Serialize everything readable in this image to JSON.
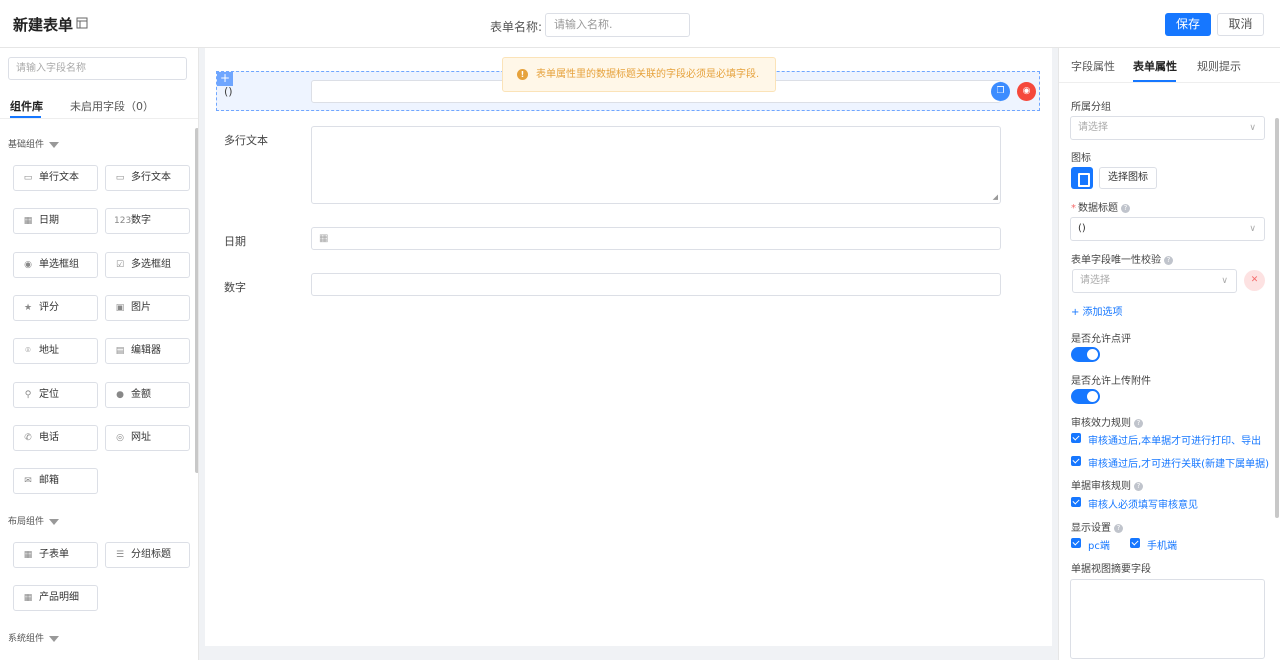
{
  "header": {
    "title": "新建表单",
    "form_name_label": "表单名称:",
    "form_name_placeholder": "请输入名称.",
    "save_label": "保存",
    "cancel_label": "取消"
  },
  "left_panel": {
    "search_placeholder": "请输入字段名称",
    "tabs": [
      "组件库",
      "未启用字段（0）"
    ],
    "sections": {
      "basic": "基础组件",
      "layout": "布局组件",
      "system": "系统组件"
    },
    "basic_components": [
      {
        "label": "单行文本",
        "icon": "single-line-icon",
        "glyph": "▭"
      },
      {
        "label": "多行文本",
        "icon": "multi-line-icon",
        "glyph": "▭"
      },
      {
        "label": "日期",
        "icon": "calendar-icon",
        "glyph": "▦"
      },
      {
        "label": "数字",
        "icon": "number-icon",
        "glyph": "123"
      },
      {
        "label": "单选框组",
        "icon": "radio-icon",
        "glyph": "◉"
      },
      {
        "label": "多选框组",
        "icon": "checkbox-icon",
        "glyph": "☑"
      },
      {
        "label": "评分",
        "icon": "star-icon",
        "glyph": "★"
      },
      {
        "label": "图片",
        "icon": "image-icon",
        "glyph": "▣"
      },
      {
        "label": "地址",
        "icon": "location-pin-icon",
        "glyph": "⌾"
      },
      {
        "label": "编辑器",
        "icon": "editor-icon",
        "glyph": "▤"
      },
      {
        "label": "定位",
        "icon": "position-icon",
        "glyph": "⚲"
      },
      {
        "label": "金额",
        "icon": "money-icon",
        "glyph": "●"
      },
      {
        "label": "电话",
        "icon": "phone-icon",
        "glyph": "✆"
      },
      {
        "label": "网址",
        "icon": "globe-icon",
        "glyph": "◎"
      },
      {
        "label": "邮箱",
        "icon": "mail-icon",
        "glyph": "✉"
      }
    ],
    "layout_components": [
      {
        "label": "子表单",
        "icon": "table-icon",
        "glyph": "▦"
      },
      {
        "label": "分组标题",
        "icon": "group-title-icon",
        "glyph": "☰"
      },
      {
        "label": "产品明细",
        "icon": "product-detail-icon",
        "glyph": "▦"
      }
    ]
  },
  "canvas": {
    "toast": "表单属性里的数据标题关联的字段必须是必填字段.",
    "fields": [
      {
        "label": "()"
      },
      {
        "label": "多行文本"
      },
      {
        "label": "日期"
      },
      {
        "label": "数字"
      }
    ]
  },
  "right_panel": {
    "tabs": [
      "字段属性",
      "表单属性",
      "规则提示"
    ],
    "group_label": "所属分组",
    "group_placeholder": "请选择",
    "icon_label": "图标",
    "choose_icon_label": "选择图标",
    "data_title_label": "数据标题",
    "data_title_value": "()",
    "unique_label": "表单字段唯一性校验",
    "unique_placeholder": "请选择",
    "add_option_label": "+ 添加选项",
    "allow_comment_label": "是否允许点评",
    "allow_attachment_label": "是否允许上传附件",
    "audit_rule_label": "审核效力规则",
    "audit_rules": [
      "审核通过后,本单据才可进行打印、导出",
      "审核通过后,才可进行关联(新建下属单据)"
    ],
    "doc_audit_label": "单据审核规则",
    "doc_audit_rules": [
      "审核人必须填写审核意见"
    ],
    "display_label": "显示设置",
    "display_options": [
      "pc端",
      "手机端"
    ],
    "summary_label": "单据视图摘要字段"
  }
}
